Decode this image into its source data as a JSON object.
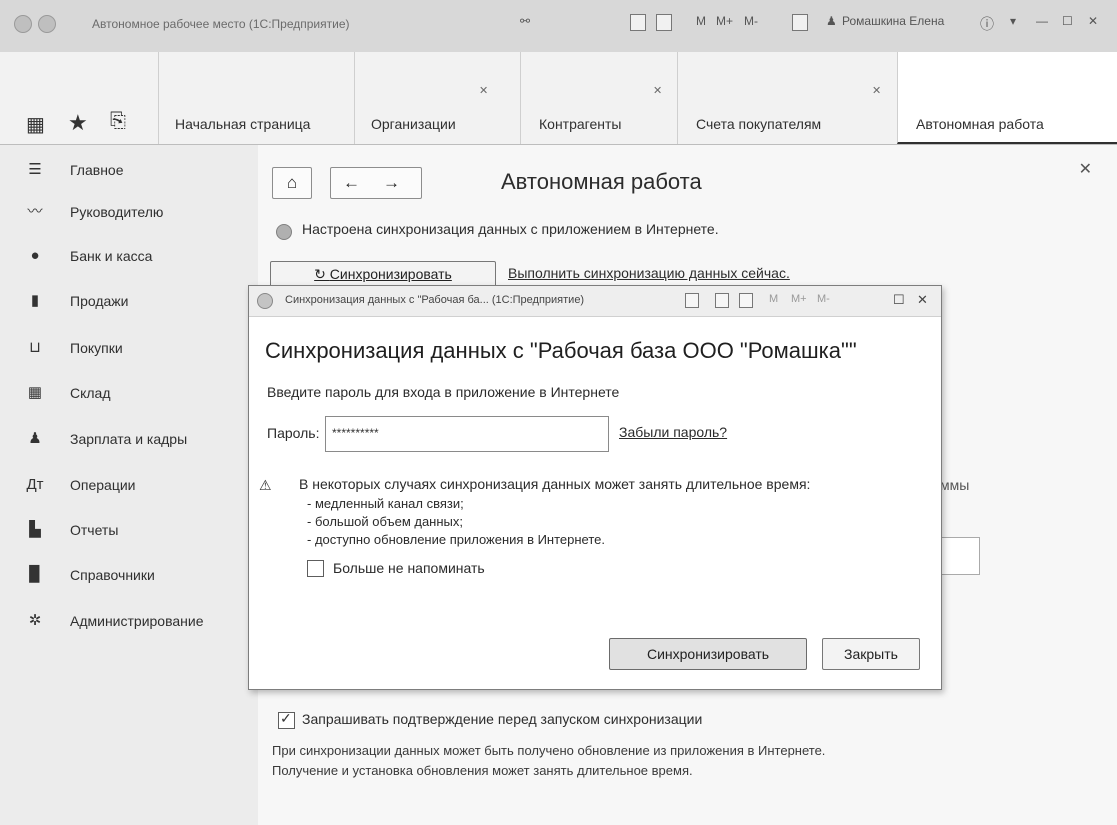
{
  "window": {
    "title": "Автономное рабочее место (1С:Предприятие)",
    "user": "Ромашкина Елена"
  },
  "toolbar": {
    "icons": [
      "apps-grid-icon",
      "star-icon",
      "history-icon"
    ]
  },
  "tabs": [
    {
      "label": "Начальная страница",
      "closable": false
    },
    {
      "label": "Организации",
      "closable": true
    },
    {
      "label": "Контрагенты",
      "closable": true
    },
    {
      "label": "Счета покупателям",
      "closable": true
    },
    {
      "label": "Автономная работа",
      "closable": false,
      "active": true
    }
  ],
  "sidebar": {
    "items": [
      {
        "label": "Главное",
        "icon": "menu-icon"
      },
      {
        "label": "Руководителю",
        "icon": "trend-icon"
      },
      {
        "label": "Банк и касса",
        "icon": "bank-icon"
      },
      {
        "label": "Продажи",
        "icon": "bag-icon"
      },
      {
        "label": "Покупки",
        "icon": "cart-icon"
      },
      {
        "label": "Склад",
        "icon": "warehouse-icon"
      },
      {
        "label": "Зарплата и кадры",
        "icon": "person-icon"
      },
      {
        "label": "Операции",
        "icon": "operations-icon"
      },
      {
        "label": "Отчеты",
        "icon": "chart-icon"
      },
      {
        "label": "Справочники",
        "icon": "book-icon"
      },
      {
        "label": "Администрирование",
        "icon": "gear-icon"
      }
    ]
  },
  "page": {
    "title": "Автономная работа",
    "status_text": "Настроена синхронизация данных с приложением в Интернете.",
    "sync_button_label": "Синхронизировать",
    "sync_description": "Выполнить синхронизацию данных сейчас.",
    "partial_right_text": "ммы",
    "confirm_checkbox_label": "Запрашивать подтверждение перед запуском синхронизации",
    "confirm_checked": true,
    "note_line1": "При синхронизации данных может быть получено обновление из приложения в Интернете.",
    "note_line2": "Получение и установка обновления может занять длительное время."
  },
  "dialog": {
    "window_title": "Синхронизация данных с \"Рабочая ба... (1С:Предприятие)",
    "heading": "Синхронизация данных с \"Рабочая база ООО \"Ромашка\"\"",
    "prompt": "Введите пароль для входа в приложение в Интернете",
    "password_label": "Пароль:",
    "password_value": "**********",
    "forgot_link": "Забыли пароль?",
    "warning_text": "В некоторых случаях синхронизация данных может занять длительное время:",
    "warning_items": [
      "- медленный канал связи;",
      "- большой объем данных;",
      "- доступно обновление приложения в Интернете."
    ],
    "dont_remind_label": "Больше не напоминать",
    "dont_remind_checked": false,
    "sync_button_label": "Синхронизировать",
    "close_button_label": "Закрыть",
    "window_controls": [
      "M",
      "M+",
      "M-"
    ]
  },
  "top_controls": [
    "M",
    "M+",
    "M-"
  ]
}
